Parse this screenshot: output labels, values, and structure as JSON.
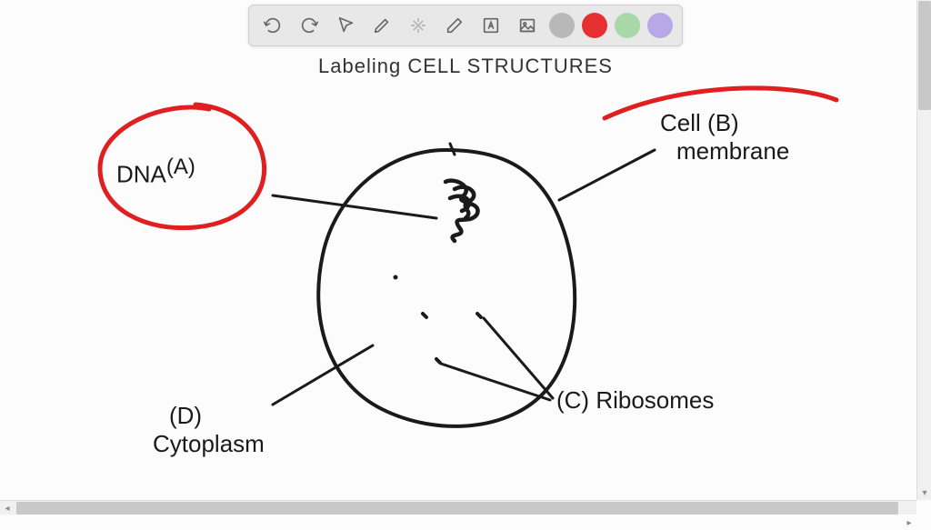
{
  "title": "Labeling CELL STRUCTURES",
  "toolbar": {
    "undo": "Undo",
    "redo": "Redo",
    "pointer": "Pointer",
    "pen": "Pen",
    "tools": "Tools",
    "eraser": "Eraser",
    "text": "Text",
    "image": "Image"
  },
  "colors": {
    "gray": "#b8b8b8",
    "red": "#e63030",
    "green": "#a8d8a8",
    "purple": "#b8a8e8"
  },
  "labels": {
    "a": {
      "letter": "(A)",
      "text": "DNA"
    },
    "b": {
      "letter": "(B)",
      "text_line1": "Cell",
      "text_line2": "membrane"
    },
    "c": {
      "letter": "(C)",
      "text": "Ribosomes"
    },
    "d": {
      "letter": "(D)",
      "text": "Cytoplasm"
    }
  }
}
